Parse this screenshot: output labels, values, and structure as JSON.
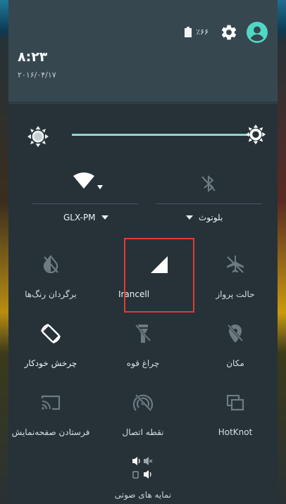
{
  "status": {
    "battery": "٪۶۶"
  },
  "header": {
    "time": "۸:۲۳",
    "date": "۲۰۱۶/۰۴/۱۷"
  },
  "brightness": {
    "level": 0.91
  },
  "wifi": {
    "network": "GLX-PM"
  },
  "bluetooth": {
    "label": "بلوتوث"
  },
  "tiles": [
    {
      "label": "برگردان رنگ‌ها",
      "icon": "invert-colors-icon",
      "active": false
    },
    {
      "label": "Irancell",
      "icon": "cell-signal-icon",
      "active": true,
      "highlighted": true
    },
    {
      "label": "حالت پرواز",
      "icon": "airplane-icon",
      "active": false
    },
    {
      "label": "چرخش خودکار",
      "icon": "auto-rotate-icon",
      "active": true
    },
    {
      "label": "چراغ قوه",
      "icon": "flashlight-icon",
      "active": false
    },
    {
      "label": "مکان",
      "icon": "location-icon",
      "active": false
    },
    {
      "label": "فرستادن صفحه‌نمایش",
      "icon": "cast-icon",
      "active": false
    },
    {
      "label": "نقطه اتصال",
      "icon": "hotspot-icon",
      "active": false
    },
    {
      "label": "HotKnot",
      "icon": "hotknot-icon",
      "active": false
    }
  ],
  "sound_profile": {
    "label": "نمایه های صوتی"
  },
  "colors": {
    "header_bg": "#37474f",
    "panel_bg": "#263238",
    "accent": "#8fd6cc",
    "highlight": "#e53935"
  }
}
